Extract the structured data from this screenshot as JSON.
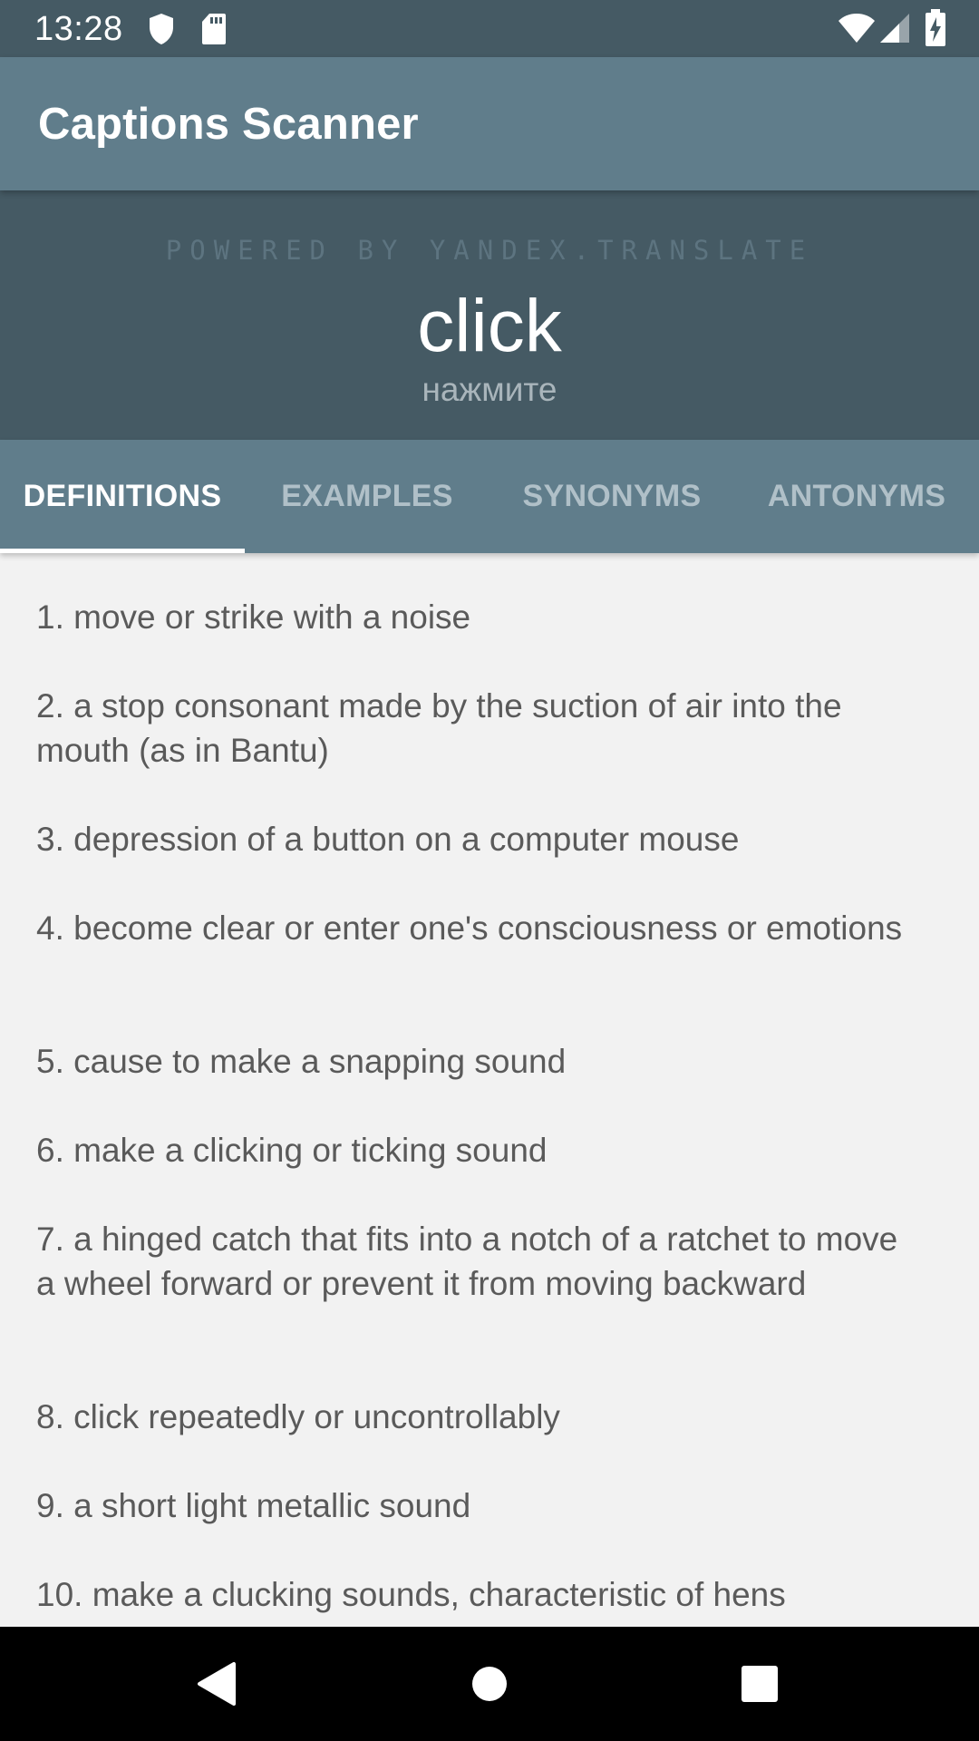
{
  "status_bar": {
    "time": "13:28",
    "left_icons": [
      "shield-icon",
      "sd-card-icon"
    ],
    "right_icons": [
      "wifi-icon",
      "signal-icon",
      "battery-charging-icon"
    ]
  },
  "app_bar": {
    "title": "Captions Scanner"
  },
  "word_header": {
    "powered_by": "POWERED BY YANDEX.TRANSLATE",
    "word": "click",
    "translation": "нажмите"
  },
  "tabs": [
    {
      "label": "DEFINITIONS",
      "selected": true
    },
    {
      "label": "EXAMPLES",
      "selected": false
    },
    {
      "label": "SYNONYMS",
      "selected": false
    },
    {
      "label": "ANTONYMS",
      "selected": false
    }
  ],
  "definitions": [
    "1. move or strike with a noise",
    "2. a stop consonant made by the suction of air into the mouth (as in Bantu)",
    "3. depression of a button on a computer mouse",
    "4. become clear or enter one's consciousness or emotions",
    "5. cause to make a snapping sound",
    "6. make a clicking or ticking sound",
    "7. a hinged catch that fits into a notch of a ratchet to move a wheel forward or prevent it from moving backward",
    "8. click repeatedly or uncontrollably",
    "9. a short light metallic sound",
    "10. make a clucking sounds, characteristic of hens"
  ],
  "nav_bar": {
    "buttons": [
      "back-icon",
      "home-icon",
      "recents-icon"
    ]
  },
  "colors": {
    "status_bar": "#455a64",
    "app_bar": "#607d8b",
    "header": "#455a64",
    "tab_bar": "#607d8b",
    "background": "#f2f2f2",
    "text": "#5a5a5a"
  }
}
